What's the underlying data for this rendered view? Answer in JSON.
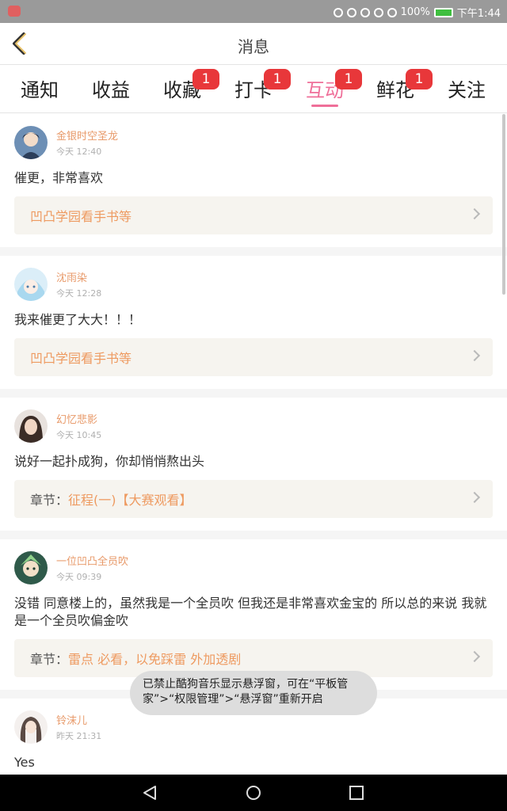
{
  "status_bar": {
    "battery": "100%",
    "time": "下午1:44"
  },
  "header": {
    "title": "消息"
  },
  "tabs": [
    {
      "label": "通知",
      "badge": ""
    },
    {
      "label": "收益",
      "badge": ""
    },
    {
      "label": "收藏",
      "badge": "1"
    },
    {
      "label": "打卡",
      "badge": "1"
    },
    {
      "label": "互动",
      "badge": "1",
      "active": true
    },
    {
      "label": "鲜花",
      "badge": "1"
    },
    {
      "label": "关注",
      "badge": ""
    }
  ],
  "feed": [
    {
      "username": "金银时空圣龙",
      "time": "今天 12:40",
      "comment": "催更，非常喜欢",
      "ref_prefix": "",
      "ref_title": "凹凸学园看手书等"
    },
    {
      "username": "沈雨染",
      "time": "今天 12:28",
      "comment": "我来催更了大大！！！",
      "ref_prefix": "",
      "ref_title": "凹凸学园看手书等"
    },
    {
      "username": "幻忆悲影",
      "time": "今天 10:45",
      "comment": "说好一起扑成狗，你却悄悄熬出头",
      "ref_prefix": "章节：",
      "ref_title": "征程(一)【大赛观看】"
    },
    {
      "username": "一位凹凸全员吹",
      "time": "今天 09:39",
      "comment": "没错 同意楼上的，虽然我是一个全员吹 但我还是非常喜欢金宝的 所以总的来说 我就是一个全员吹偏金吹",
      "ref_prefix": "章节：",
      "ref_title": "雷点 必看，以免踩雷  外加透剧"
    },
    {
      "username": "铃沫儿",
      "time": "昨天 21:31",
      "comment": "Yes",
      "ref_prefix": "",
      "ref_title": ""
    }
  ],
  "toast": {
    "text": "已禁止酷狗音乐显示悬浮窗，可在“平板管家”>“权限管理”>“悬浮窗”重新开启"
  },
  "colors": {
    "accent": "#ef6f99",
    "badge": "#e8373a",
    "username": "#e89a6a",
    "ref_title": "#ee9a60"
  }
}
